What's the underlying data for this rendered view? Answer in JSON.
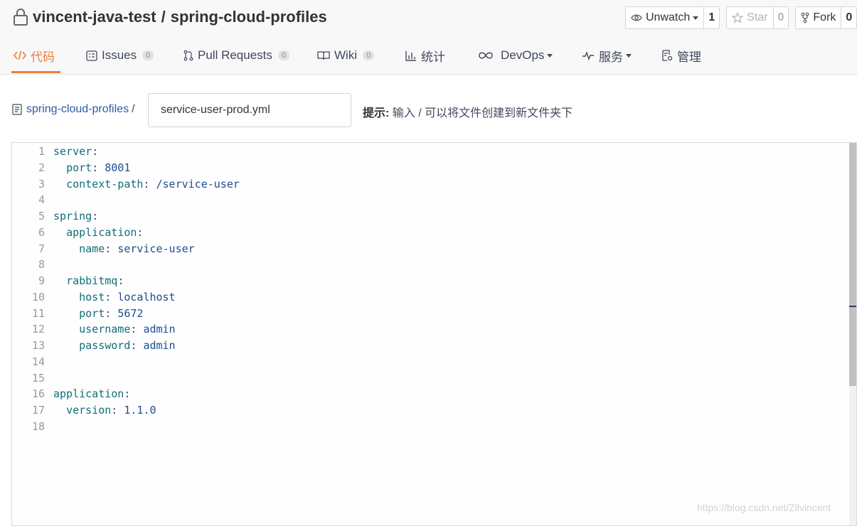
{
  "repo": {
    "owner": "vincent-java-test",
    "separator": "/",
    "name": "spring-cloud-profiles"
  },
  "actions": {
    "watch": {
      "label": "Unwatch",
      "count": "1"
    },
    "star": {
      "label": "Star",
      "count": "0"
    },
    "fork": {
      "label": "Fork",
      "count": "0"
    }
  },
  "tabs": [
    {
      "label": "代码",
      "active": true
    },
    {
      "label": "Issues",
      "badge": "0"
    },
    {
      "label": "Pull Requests",
      "badge": "0"
    },
    {
      "label": "Wiki",
      "badge": "0"
    },
    {
      "label": "统计"
    },
    {
      "label": "DevOps",
      "dropdown": true
    },
    {
      "label": "服务",
      "dropdown": true
    },
    {
      "label": "管理"
    }
  ],
  "path": {
    "root": "spring-cloud-profiles",
    "slash": "/",
    "filename": "service-user-prod.yml"
  },
  "hint": {
    "prefix": "提示:",
    "text": "输入 / 可以将文件创建到新文件夹下"
  },
  "code_lines": [
    {
      "n": "1",
      "key": "server",
      "value": "",
      "indent": ""
    },
    {
      "n": "2",
      "key": "port",
      "value": "8001",
      "indent": "  "
    },
    {
      "n": "3",
      "key": "context-path",
      "value": "/service-user",
      "indent": "  "
    },
    {
      "n": "4",
      "key": "",
      "value": "",
      "indent": ""
    },
    {
      "n": "5",
      "key": "spring",
      "value": "",
      "indent": ""
    },
    {
      "n": "6",
      "key": "application",
      "value": "",
      "indent": "  "
    },
    {
      "n": "7",
      "key": "name",
      "value": "service-user",
      "indent": "    "
    },
    {
      "n": "8",
      "key": "",
      "value": "",
      "indent": ""
    },
    {
      "n": "9",
      "key": "rabbitmq",
      "value": "",
      "indent": "  "
    },
    {
      "n": "10",
      "key": "host",
      "value": "localhost",
      "indent": "    "
    },
    {
      "n": "11",
      "key": "port",
      "value": "5672",
      "indent": "    "
    },
    {
      "n": "12",
      "key": "username",
      "value": "admin",
      "indent": "    "
    },
    {
      "n": "13",
      "key": "password",
      "value": "admin",
      "indent": "    "
    },
    {
      "n": "14",
      "key": "",
      "value": "",
      "indent": ""
    },
    {
      "n": "15",
      "key": "",
      "value": "",
      "indent": ""
    },
    {
      "n": "16",
      "key": "application",
      "value": "",
      "indent": ""
    },
    {
      "n": "17",
      "key": "version",
      "value": "1.1.0",
      "indent": "  "
    },
    {
      "n": "18",
      "key": "",
      "value": "",
      "indent": ""
    }
  ],
  "watermark": "https://blog.csdn.net/Zllvincent",
  "colors": {
    "accent": "#f07c3c",
    "link": "#2f5aa5",
    "yaml_key": "#116d7b",
    "yaml_value": "#1f4c8f"
  }
}
